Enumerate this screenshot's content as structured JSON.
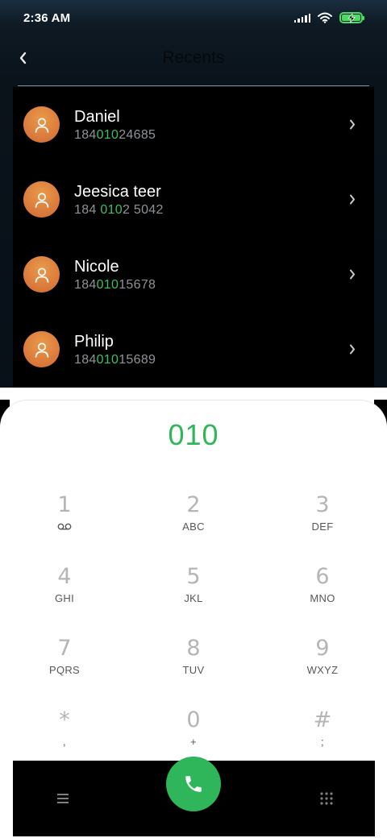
{
  "status_bar": {
    "time": "2:36 AM",
    "icons": [
      "signal-icon",
      "wifi-icon",
      "battery-charging-icon"
    ]
  },
  "header": {
    "title": "Recents",
    "back_icon": "chevron-left-icon"
  },
  "contacts": [
    {
      "name": "Daniel",
      "number_pre": "184",
      "number_match": "010",
      "number_post": "24685"
    },
    {
      "name": "Jeesica teer",
      "number_pre": "184 ",
      "number_match": "010",
      "number_post": "2 5042"
    },
    {
      "name": "Nicole",
      "number_pre": "184",
      "number_match": "010",
      "number_post": "15678"
    },
    {
      "name": "Philip",
      "number_pre": "184",
      "number_match": "010",
      "number_post": "15689"
    }
  ],
  "dialer": {
    "entered_number": "010",
    "keys": [
      {
        "digit": "1",
        "letters": ""
      },
      {
        "digit": "2",
        "letters": "ABC"
      },
      {
        "digit": "3",
        "letters": "DEF"
      },
      {
        "digit": "4",
        "letters": "GHI"
      },
      {
        "digit": "5",
        "letters": "JKL"
      },
      {
        "digit": "6",
        "letters": "MNO"
      },
      {
        "digit": "7",
        "letters": "PQRS"
      },
      {
        "digit": "8",
        "letters": "TUV"
      },
      {
        "digit": "9",
        "letters": "WXYZ"
      },
      {
        "digit": "*",
        "letters": ","
      },
      {
        "digit": "0",
        "letters": "+"
      },
      {
        "digit": "#",
        "letters": ";"
      }
    ]
  },
  "bottom_bar": {
    "left_icon": "menu-icon",
    "center_icon": "phone-icon",
    "right_icon": "dialpad-icon"
  },
  "colors": {
    "accent_green": "#2fb55a",
    "avatar_orange": "#d9773a",
    "match_green": "#3cbf63"
  }
}
